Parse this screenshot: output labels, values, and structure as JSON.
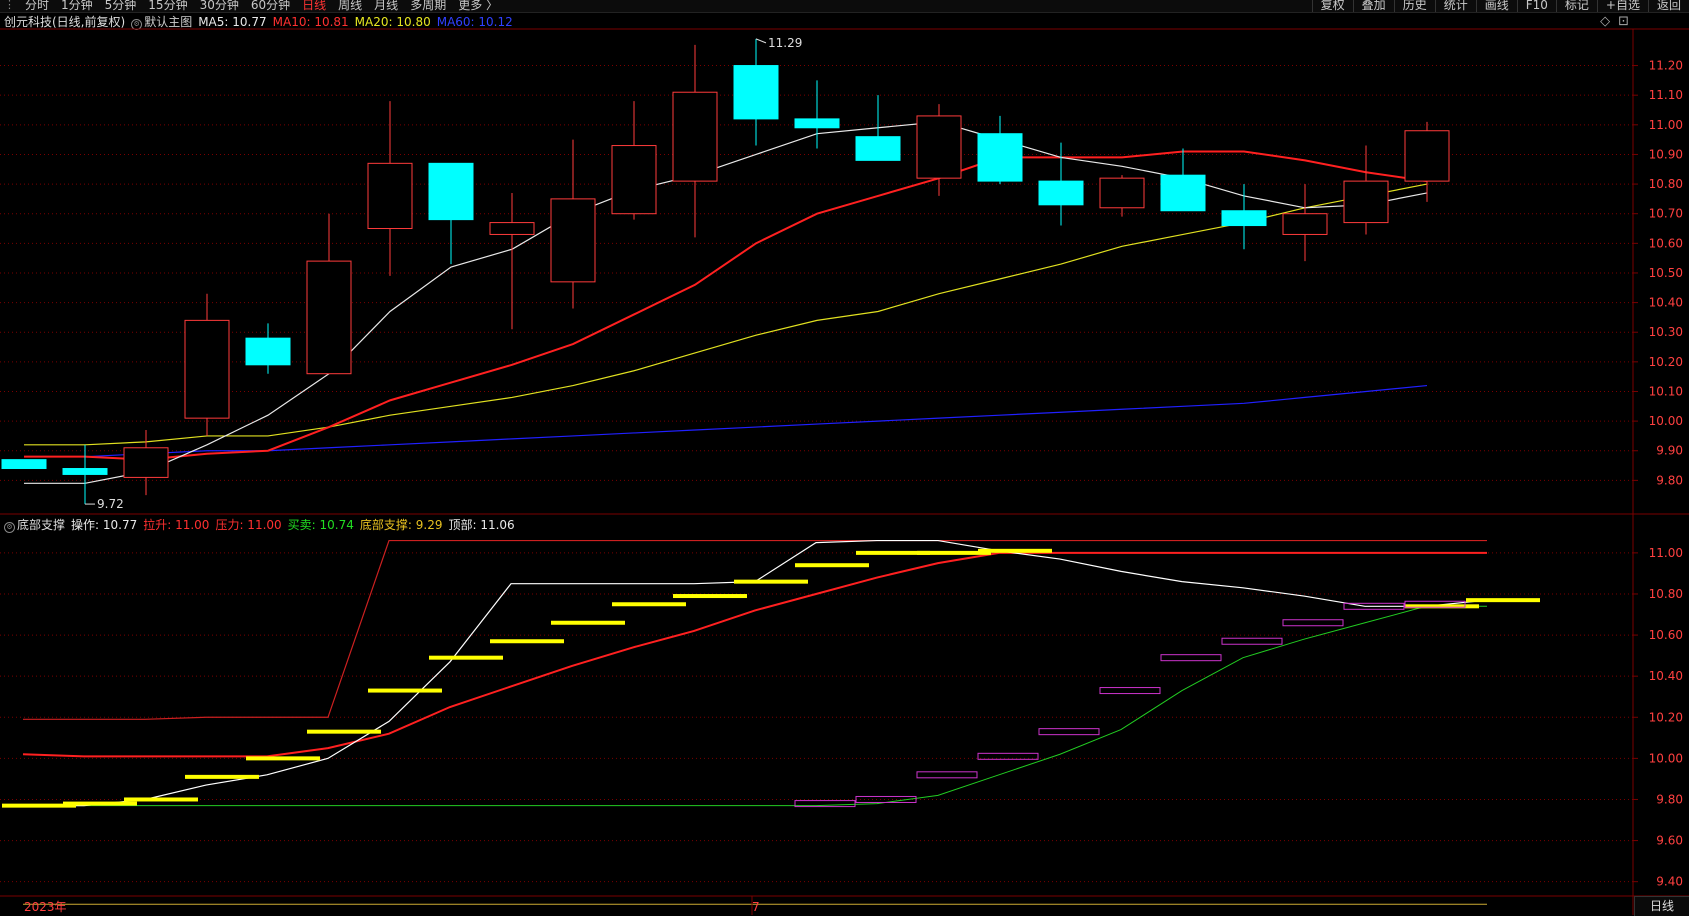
{
  "toolbar": {
    "tabs": [
      "分时",
      "1分钟",
      "5分钟",
      "15分钟",
      "30分钟",
      "60分钟",
      "日线",
      "周线",
      "月线",
      "多周期",
      "更多 〉"
    ],
    "active_tab": "日线",
    "right_buttons": [
      "复权",
      "叠加",
      "历史",
      "统计",
      "画线",
      "F10",
      "+自选",
      "返回"
    ],
    "right_extra": "标记"
  },
  "main_legend": {
    "title": "创元科技(日线,前复权)",
    "indicator": "默认主图",
    "ma5": "MA5: 10.77",
    "ma10": "MA10: 10.81",
    "ma20": "MA20: 10.80",
    "ma60": "MA60: 10.12"
  },
  "sub_legend": {
    "name": "底部支撑",
    "op": "操作: 10.77",
    "lashen": "拉升: 11.00",
    "yali": "压力: 11.00",
    "maimai": "买卖: 10.74",
    "dibu": "底部支撑: 9.29",
    "dingbu": "顶部: 11.06"
  },
  "window_icons": {
    "diamond": "◇",
    "restore": "⊡"
  },
  "footer": {
    "year_label": "2023年",
    "month_label": "7",
    "period": "日线"
  },
  "colors": {
    "up": "#ff3b3b",
    "down": "#00ffff",
    "ma5": "#e8e8e8",
    "ma10": "#ff2020",
    "ma20": "#e0e020",
    "ma60": "#2020ff",
    "grid": "#7a0000",
    "yellow": "#ffff00",
    "magenta": "#cc33cc",
    "green": "#22cc22"
  },
  "chart_data": [
    {
      "type": "candlestick",
      "title": "创元科技(日线,前复权)",
      "ylim": [
        9.7,
        11.32
      ],
      "y_ticks": [
        9.8,
        9.9,
        10.0,
        10.1,
        10.2,
        10.3,
        10.4,
        10.5,
        10.6,
        10.7,
        10.8,
        10.9,
        11.0,
        11.1,
        11.2
      ],
      "annotations": [
        {
          "label": "11.29",
          "value": 11.29,
          "index": 12
        },
        {
          "label": "9.72",
          "value": 9.72,
          "index": 1
        }
      ],
      "candles": [
        {
          "o": 9.87,
          "h": 9.87,
          "l": 9.84,
          "c": 9.84
        },
        {
          "o": 9.84,
          "h": 9.92,
          "l": 9.72,
          "c": 9.82
        },
        {
          "o": 9.81,
          "h": 9.97,
          "l": 9.75,
          "c": 9.91
        },
        {
          "o": 10.01,
          "h": 10.43,
          "l": 9.95,
          "c": 10.34
        },
        {
          "o": 10.28,
          "h": 10.33,
          "l": 10.16,
          "c": 10.19
        },
        {
          "o": 10.16,
          "h": 10.7,
          "l": 10.16,
          "c": 10.54
        },
        {
          "o": 10.65,
          "h": 11.08,
          "l": 10.49,
          "c": 10.87
        },
        {
          "o": 10.87,
          "h": 10.87,
          "l": 10.53,
          "c": 10.68
        },
        {
          "o": 10.63,
          "h": 10.77,
          "l": 10.31,
          "c": 10.67
        },
        {
          "o": 10.47,
          "h": 10.95,
          "l": 10.38,
          "c": 10.75
        },
        {
          "o": 10.7,
          "h": 11.08,
          "l": 10.68,
          "c": 10.93
        },
        {
          "o": 10.81,
          "h": 11.27,
          "l": 10.62,
          "c": 11.11
        },
        {
          "o": 11.2,
          "h": 11.29,
          "l": 10.93,
          "c": 11.02
        },
        {
          "o": 11.02,
          "h": 11.15,
          "l": 10.92,
          "c": 10.99
        },
        {
          "o": 10.96,
          "h": 11.1,
          "l": 10.88,
          "c": 10.88
        },
        {
          "o": 10.82,
          "h": 11.07,
          "l": 10.76,
          "c": 11.03
        },
        {
          "o": 10.97,
          "h": 11.03,
          "l": 10.8,
          "c": 10.81
        },
        {
          "o": 10.81,
          "h": 10.94,
          "l": 10.66,
          "c": 10.73
        },
        {
          "o": 10.72,
          "h": 10.83,
          "l": 10.69,
          "c": 10.82
        },
        {
          "o": 10.83,
          "h": 10.92,
          "l": 10.72,
          "c": 10.71
        },
        {
          "o": 10.71,
          "h": 10.8,
          "l": 10.58,
          "c": 10.66
        },
        {
          "o": 10.63,
          "h": 10.8,
          "l": 10.54,
          "c": 10.7
        },
        {
          "o": 10.67,
          "h": 10.93,
          "l": 10.63,
          "c": 10.81
        },
        {
          "o": 10.81,
          "h": 11.01,
          "l": 10.74,
          "c": 10.98
        }
      ],
      "series": [
        {
          "name": "MA5",
          "values": [
            9.79,
            9.79,
            9.83,
            9.92,
            10.02,
            10.16,
            10.37,
            10.52,
            10.58,
            10.7,
            10.78,
            10.83,
            10.9,
            10.97,
            10.99,
            11.01,
            10.95,
            10.89,
            10.86,
            10.82,
            10.76,
            10.72,
            10.73,
            10.77
          ]
        },
        {
          "name": "MA10",
          "values": [
            9.88,
            9.88,
            9.87,
            9.89,
            9.9,
            9.98,
            10.07,
            10.13,
            10.19,
            10.26,
            10.36,
            10.46,
            10.6,
            10.7,
            10.76,
            10.82,
            10.89,
            10.89,
            10.89,
            10.91,
            10.91,
            10.88,
            10.84,
            10.81
          ]
        },
        {
          "name": "MA20",
          "values": [
            9.92,
            9.92,
            9.93,
            9.95,
            9.95,
            9.98,
            10.02,
            10.05,
            10.08,
            10.12,
            10.17,
            10.23,
            10.29,
            10.34,
            10.37,
            10.43,
            10.48,
            10.53,
            10.59,
            10.63,
            10.67,
            10.72,
            10.76,
            10.8
          ]
        },
        {
          "name": "MA60",
          "values": [
            9.88,
            9.88,
            9.89,
            9.9,
            9.9,
            9.91,
            9.92,
            9.93,
            9.94,
            9.95,
            9.96,
            9.97,
            9.98,
            9.99,
            10.0,
            10.01,
            10.02,
            10.03,
            10.04,
            10.05,
            10.06,
            10.08,
            10.1,
            10.12
          ]
        }
      ]
    },
    {
      "type": "line",
      "title": "底部支撑",
      "ylim": [
        9.34,
        11.16
      ],
      "y_ticks": [
        9.4,
        9.6,
        9.8,
        10.0,
        10.2,
        10.4,
        10.6,
        10.8,
        11.0
      ],
      "series": [
        {
          "name": "操作",
          "values": [
            9.77,
            9.77,
            9.8,
            9.87,
            9.92,
            10.0,
            10.18,
            10.47,
            10.85,
            10.85,
            10.85,
            10.85,
            10.86,
            11.05,
            11.06,
            11.06,
            11.01,
            10.97,
            10.91,
            10.86,
            10.83,
            10.79,
            10.74,
            10.74,
            10.77
          ]
        },
        {
          "name": "拉升",
          "values": [
            10.02,
            10.01,
            10.01,
            10.01,
            10.01,
            10.05,
            10.12,
            10.25,
            10.35,
            10.45,
            10.54,
            10.62,
            10.72,
            10.8,
            10.88,
            10.95,
            11.0,
            11.0,
            11.0,
            11.0,
            11.0,
            11.0,
            11.0,
            11.0,
            11.0
          ]
        },
        {
          "name": "压力",
          "values": [
            10.19,
            10.19,
            10.19,
            10.2,
            10.2,
            10.2,
            11.06,
            11.06,
            11.06,
            11.06,
            11.06,
            11.06,
            11.06,
            11.06,
            11.06,
            11.06,
            11.06,
            11.06,
            11.06,
            11.06,
            11.06,
            11.06,
            11.06,
            11.06,
            11.06
          ]
        },
        {
          "name": "底部",
          "values": [
            9.77,
            9.77,
            9.77,
            9.77,
            9.77,
            9.77,
            9.77,
            9.77,
            9.77,
            9.77,
            9.77,
            9.77,
            9.77,
            9.77,
            9.78,
            9.82,
            9.92,
            10.02,
            10.14,
            10.33,
            10.49,
            10.58,
            10.66,
            10.74,
            10.74
          ]
        },
        {
          "name": "底部支撑",
          "values": [
            9.29,
            9.29,
            9.29,
            9.29,
            9.29,
            9.29,
            9.29,
            9.29,
            9.29,
            9.29,
            9.29,
            9.29,
            9.29,
            9.29,
            9.29,
            9.29,
            9.29,
            9.29,
            9.29,
            9.29,
            9.29,
            9.29,
            9.29,
            9.29,
            9.29
          ]
        }
      ],
      "yellow_bars": [
        9.77,
        9.78,
        9.8,
        9.91,
        10.0,
        10.13,
        10.33,
        10.49,
        10.57,
        10.66,
        10.75,
        10.79,
        10.86,
        10.94,
        11.0,
        11.0,
        11.01,
        10.74,
        10.77
      ],
      "magenta_bars": [
        9.78,
        9.8,
        9.92,
        10.01,
        10.13,
        10.33,
        10.49,
        10.57,
        10.66,
        10.74,
        10.75
      ]
    }
  ]
}
